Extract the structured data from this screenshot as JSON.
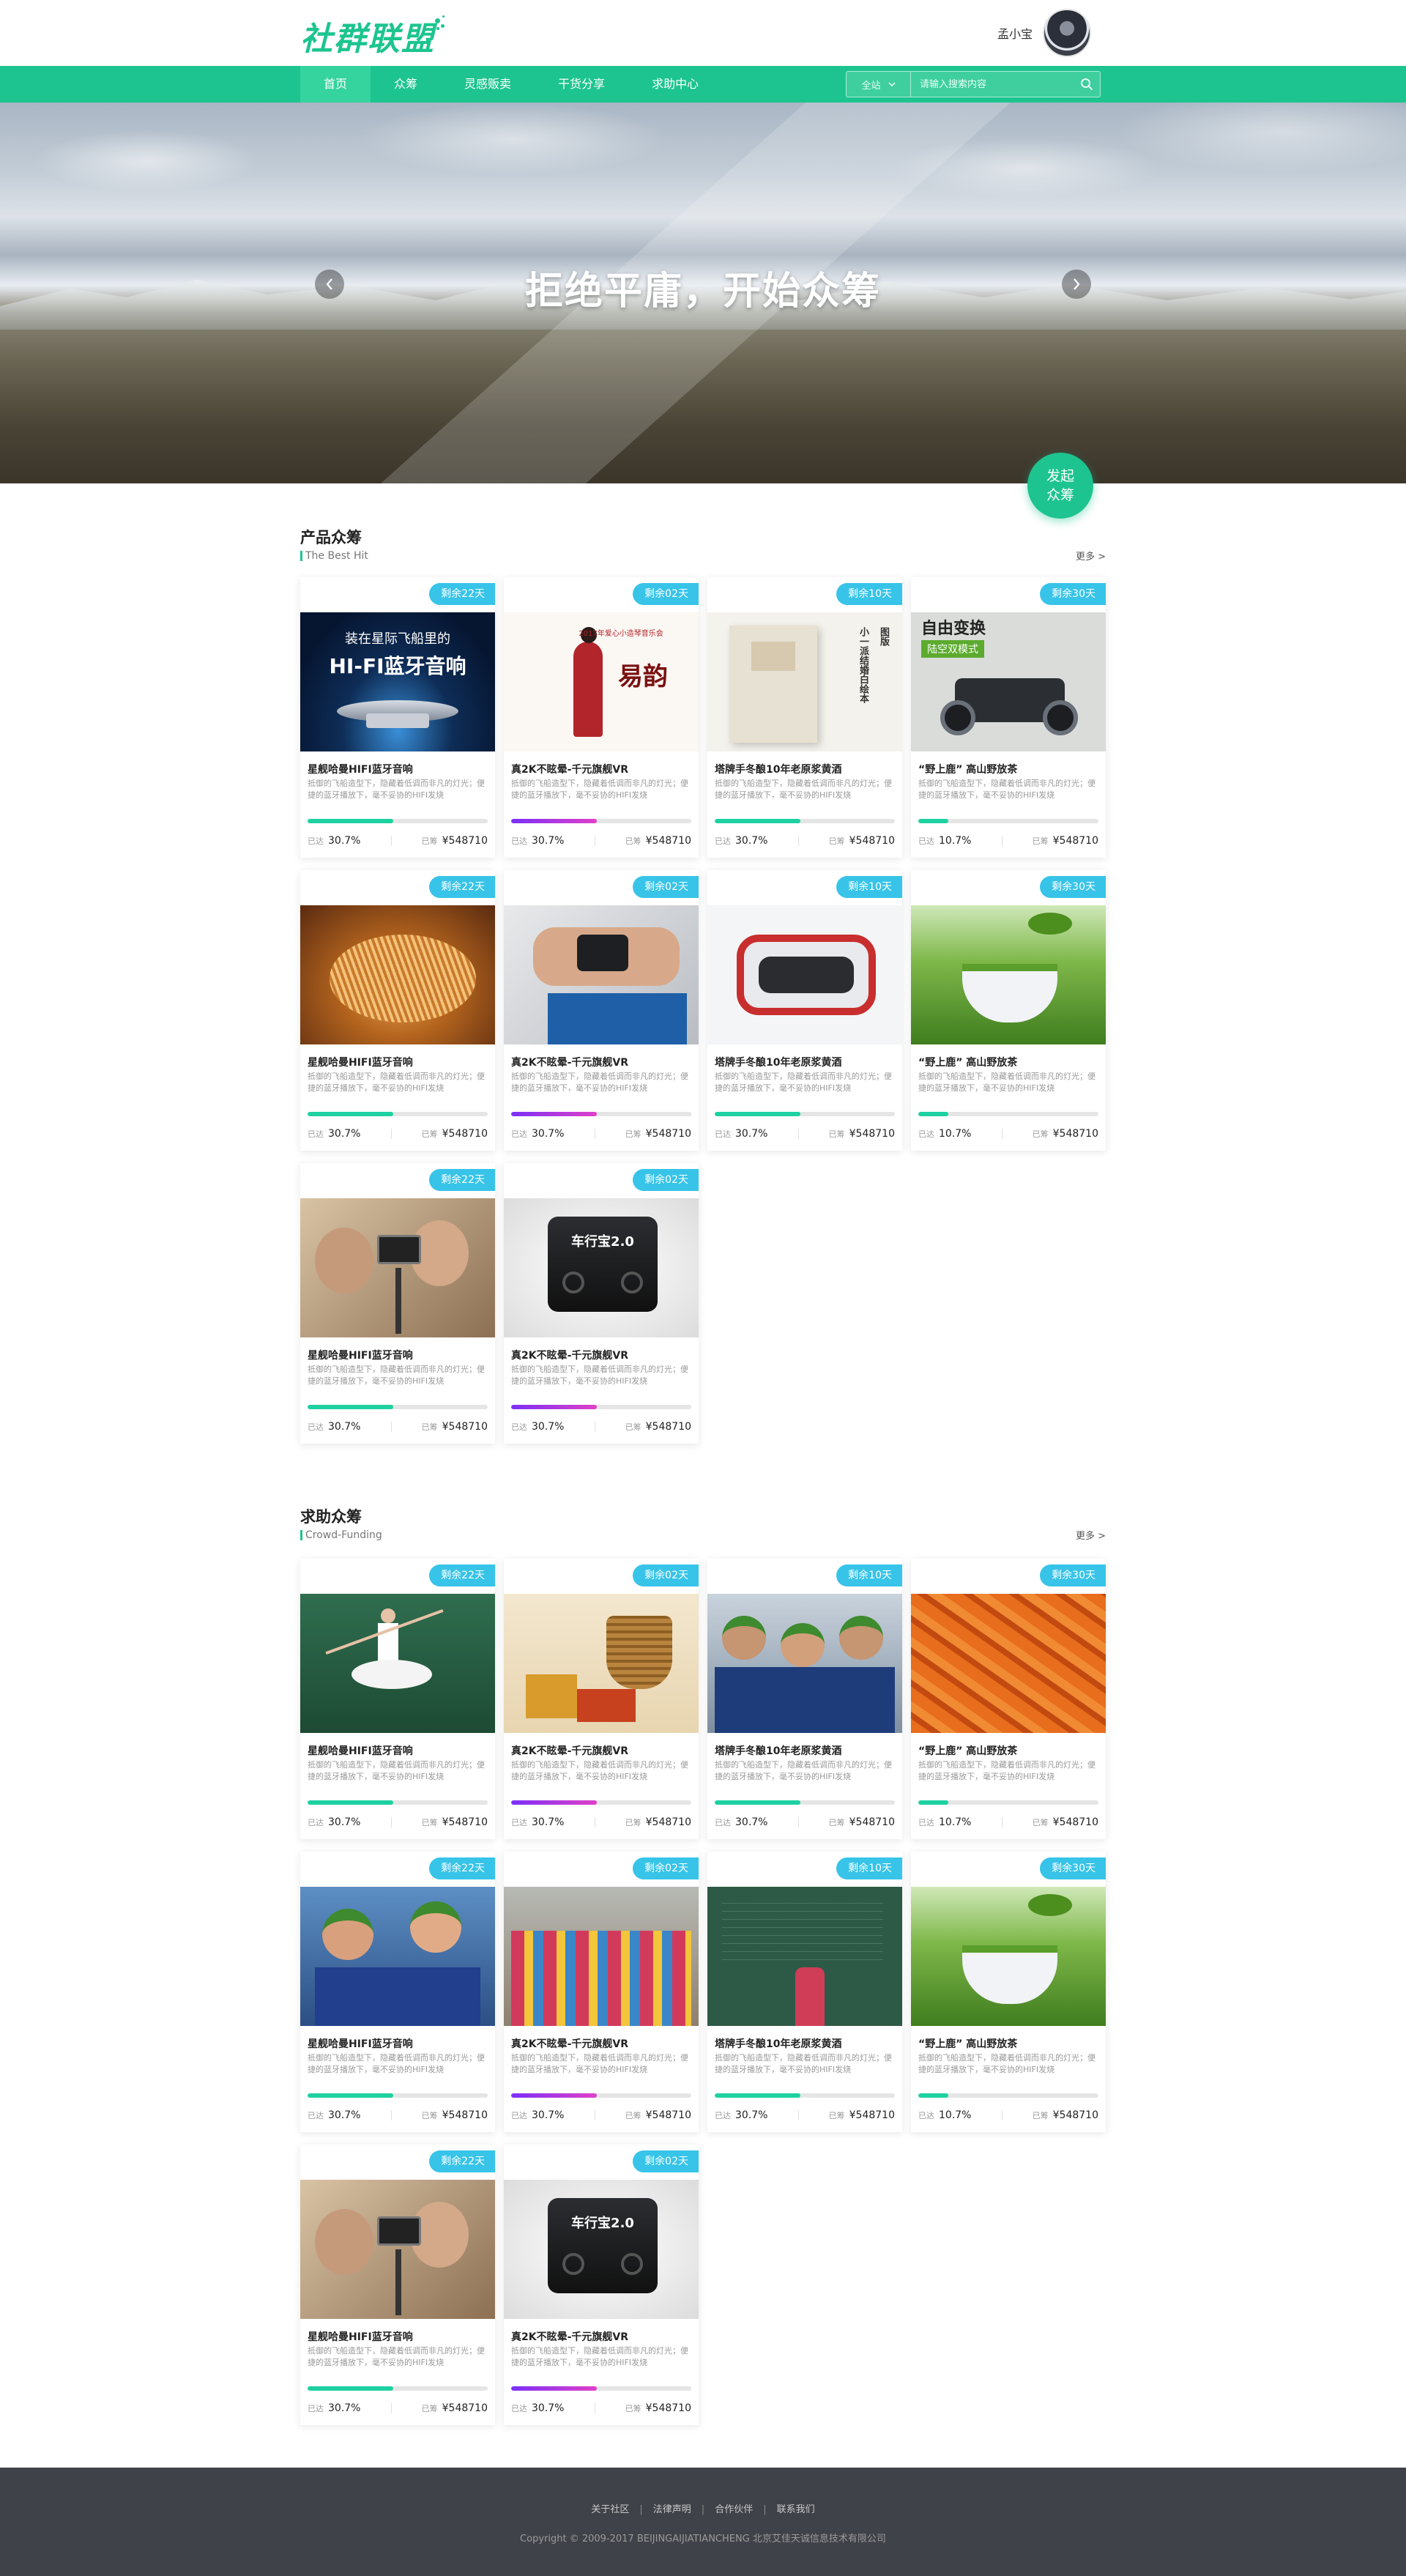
{
  "brand": {
    "logo_text": "社群联盟",
    "accent": "#1dc48f",
    "badge_color": "#37c4e8"
  },
  "user": {
    "name": "孟小宝"
  },
  "nav": {
    "items": [
      "首页",
      "众筹",
      "灵感贩卖",
      "干货分享",
      "求助中心"
    ],
    "active": 0,
    "search": {
      "scope": "全站",
      "placeholder": "请输入搜索内容"
    }
  },
  "banner": {
    "title": "拒绝平庸，开始众筹",
    "cta": [
      "发起",
      "众筹"
    ]
  },
  "sections": [
    {
      "title": "产品众筹",
      "subtitle": "The Best Hit",
      "more": "更多 >",
      "cards": [
        {
          "badge": "剩余22天",
          "title": "星舰哈曼HIFI蓝牙音响",
          "desc": "抵御的飞船造型下，隐藏着低调而非凡的灯光；便捷的蓝牙播放下，毫不妥协的HIFI发烧",
          "progress": 30.7,
          "fill": "green",
          "rate": "30.7%",
          "raised": "¥548710",
          "image": "speaker",
          "image_text": [
            "装在星际飞船里的",
            "HI-FI蓝牙音响"
          ]
        },
        {
          "badge": "剩余02天",
          "title": "真2K不眩晕-千元旗舰VR",
          "desc": "抵御的飞船造型下，隐藏着低调而非凡的灯光；便捷的蓝牙播放下，毫不妥协的HIFI发烧",
          "progress": 30.7,
          "fill": "purple",
          "rate": "30.7%",
          "raised": "¥548710",
          "image": "concert",
          "image_text": [
            "2017年爱心小造琴音乐会",
            "易韵"
          ]
        },
        {
          "badge": "剩余10天",
          "title": "塔牌手冬酿10年老原浆黄酒",
          "desc": "抵御的飞船造型下，隐藏着低调而非凡的灯光；便捷的蓝牙播放下，毫不妥协的HIFI发烧",
          "progress": 30.7,
          "fill": "green",
          "rate": "30.7%",
          "raised": "¥548710",
          "image": "book",
          "image_text": [
            "小一派结婚白绘本",
            "图版"
          ]
        },
        {
          "badge": "剩余30天",
          "title": "“野上鹿” 高山野放茶",
          "desc": "抵御的飞船造型下，隐藏着低调而非凡的灯光；便捷的蓝牙播放下，毫不妥协的HIFI发烧",
          "progress": 10.7,
          "fill": "green",
          "rate": "10.7%",
          "raised": "¥548710",
          "image": "car",
          "image_text": [
            "自由变换",
            "陆空双模式"
          ]
        },
        {
          "badge": "剩余22天",
          "title": "星舰哈曼HIFI蓝牙音响",
          "desc": "抵御的飞船造型下，隐藏着低调而非凡的灯光；便捷的蓝牙播放下，毫不妥协的HIFI发烧",
          "progress": 30.7,
          "fill": "green",
          "rate": "30.7%",
          "raised": "¥548710",
          "image": "noodles",
          "image_text": []
        },
        {
          "badge": "剩余02天",
          "title": "真2K不眩晕-千元旗舰VR",
          "desc": "抵御的飞船造型下，隐藏着低调而非凡的灯光；便捷的蓝牙播放下，毫不妥协的HIFI发烧",
          "progress": 30.7,
          "fill": "purple",
          "rate": "30.7%",
          "raised": "¥548710",
          "image": "band",
          "image_text": []
        },
        {
          "badge": "剩余10天",
          "title": "塔牌手冬酿10年老原浆黄酒",
          "desc": "抵御的飞船造型下，隐藏着低调而非凡的灯光；便捷的蓝牙播放下，毫不妥协的HIFI发烧",
          "progress": 30.7,
          "fill": "green",
          "rate": "30.7%",
          "raised": "¥548710",
          "image": "vr",
          "image_text": []
        },
        {
          "badge": "剩余30天",
          "title": "“野上鹿” 高山野放茶",
          "desc": "抵御的飞船造型下，隐藏着低调而非凡的灯光；便捷的蓝牙播放下，毫不妥协的HIFI发烧",
          "progress": 10.7,
          "fill": "green",
          "rate": "10.7%",
          "raised": "¥548710",
          "image": "tea",
          "image_text": []
        },
        {
          "badge": "剩余22天",
          "title": "星舰哈曼HIFI蓝牙音响",
          "desc": "抵御的飞船造型下，隐藏着低调而非凡的灯光；便捷的蓝牙播放下，毫不妥协的HIFI发烧",
          "progress": 30.7,
          "fill": "green",
          "rate": "30.7%",
          "raised": "¥548710",
          "image": "selfie",
          "image_text": []
        },
        {
          "badge": "剩余02天",
          "title": "真2K不眩晕-千元旗舰VR",
          "desc": "抵御的飞船造型下，隐藏着低调而非凡的灯光；便捷的蓝牙播放下，毫不妥协的HIFI发烧",
          "progress": 30.7,
          "fill": "purple",
          "rate": "30.7%",
          "raised": "¥548710",
          "image": "device",
          "image_text": [
            "车行宝2.0"
          ]
        }
      ]
    },
    {
      "title": "求助众筹",
      "subtitle": "Crowd-Funding",
      "more": "更多 >",
      "cards": [
        {
          "badge": "剩余22天",
          "title": "星舰哈曼HIFI蓝牙音响",
          "desc": "抵御的飞船造型下，隐藏着低调而非凡的灯光；便捷的蓝牙播放下，毫不妥协的HIFI发烧",
          "progress": 30.7,
          "fill": "green",
          "rate": "30.7%",
          "raised": "¥548710",
          "image": "ballet",
          "image_text": []
        },
        {
          "badge": "剩余02天",
          "title": "真2K不眩晕-千元旗舰VR",
          "desc": "抵御的飞船造型下，隐藏着低调而非凡的灯光；便捷的蓝牙播放下，毫不妥协的HIFI发烧",
          "progress": 30.7,
          "fill": "purple",
          "rate": "30.7%",
          "raised": "¥548710",
          "image": "gifts",
          "image_text": []
        },
        {
          "badge": "剩余10天",
          "title": "塔牌手冬酿10年老原浆黄酒",
          "desc": "抵御的飞船造型下，隐藏着低调而非凡的灯光；便捷的蓝牙播放下，毫不妥协的HIFI发烧",
          "progress": 30.7,
          "fill": "green",
          "rate": "30.7%",
          "raised": "¥548710",
          "image": "kids",
          "image_text": []
        },
        {
          "badge": "剩余30天",
          "title": "“野上鹿” 高山野放茶",
          "desc": "抵御的飞船造型下，隐藏着低调而非凡的灯光；便捷的蓝牙播放下，毫不妥协的HIFI发烧",
          "progress": 10.7,
          "fill": "green",
          "rate": "10.7%",
          "raised": "¥548710",
          "image": "fish",
          "image_text": []
        },
        {
          "badge": "剩余22天",
          "title": "星舰哈曼HIFI蓝牙音响",
          "desc": "抵御的飞船造型下，隐藏着低调而非凡的灯光；便捷的蓝牙播放下，毫不妥协的HIFI发烧",
          "progress": 30.7,
          "fill": "green",
          "rate": "30.7%",
          "raised": "¥548710",
          "image": "kids2",
          "image_text": []
        },
        {
          "badge": "剩余02天",
          "title": "真2K不眩晕-千元旗舰VR",
          "desc": "抵御的飞船造型下，隐藏着低调而非凡的灯光；便捷的蓝牙播放下，毫不妥协的HIFI发烧",
          "progress": 30.7,
          "fill": "purple",
          "rate": "30.7%",
          "raised": "¥548710",
          "image": "group",
          "image_text": []
        },
        {
          "badge": "剩余10天",
          "title": "塔牌手冬酿10年老原浆黄酒",
          "desc": "抵御的飞船造型下，隐藏着低调而非凡的灯光；便捷的蓝牙播放下，毫不妥协的HIFI发烧",
          "progress": 30.7,
          "fill": "green",
          "rate": "30.7%",
          "raised": "¥548710",
          "image": "chalkboard",
          "image_text": []
        },
        {
          "badge": "剩余30天",
          "title": "“野上鹿” 高山野放茶",
          "desc": "抵御的飞船造型下，隐藏着低调而非凡的灯光；便捷的蓝牙播放下，毫不妥协的HIFI发烧",
          "progress": 10.7,
          "fill": "green",
          "rate": "10.7%",
          "raised": "¥548710",
          "image": "tea",
          "image_text": []
        },
        {
          "badge": "剩余22天",
          "title": "星舰哈曼HIFI蓝牙音响",
          "desc": "抵御的飞船造型下，隐藏着低调而非凡的灯光；便捷的蓝牙播放下，毫不妥协的HIFI发烧",
          "progress": 30.7,
          "fill": "green",
          "rate": "30.7%",
          "raised": "¥548710",
          "image": "selfie",
          "image_text": []
        },
        {
          "badge": "剩余02天",
          "title": "真2K不眩晕-千元旗舰VR",
          "desc": "抵御的飞船造型下，隐藏着低调而非凡的灯光；便捷的蓝牙播放下，毫不妥协的HIFI发烧",
          "progress": 30.7,
          "fill": "purple",
          "rate": "30.7%",
          "raised": "¥548710",
          "image": "device",
          "image_text": [
            "车行宝2.0"
          ]
        }
      ]
    }
  ],
  "card_labels": {
    "rate": "已达",
    "raised": "已筹"
  },
  "footer": {
    "links": [
      "关于社区",
      "法律声明",
      "合作伙伴",
      "联系我们"
    ],
    "copyright": "Copyright © 2009-2017 BEIJINGAIJIATIANCHENG 北京艾佳天诚信息技术有限公司"
  }
}
